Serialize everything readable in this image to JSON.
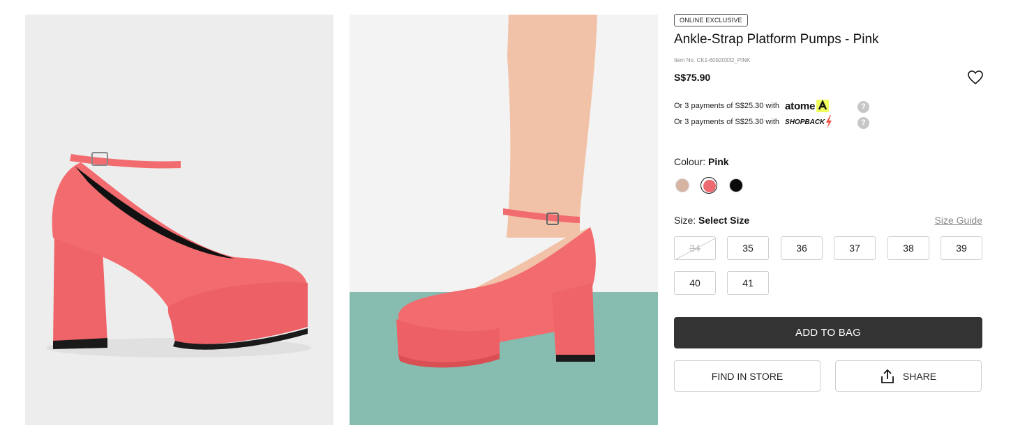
{
  "product": {
    "badge": "ONLINE EXCLUSIVE",
    "title": "Ankle-Strap Platform Pumps - Pink",
    "item_no": "Item No. CK1-60920332_PINK",
    "price": "S$75.90"
  },
  "payments": [
    {
      "text": "Or 3 payments of S$25.30 with",
      "provider": "atome"
    },
    {
      "text": "Or 3 payments of S$25.30 with",
      "provider": "SHOPBACK"
    }
  ],
  "help_icon_glyph": "?",
  "colour": {
    "label": "Colour:",
    "selected": "Pink",
    "swatches": [
      {
        "name": "nude",
        "hex": "#d7b3a3"
      },
      {
        "name": "pink",
        "hex": "#ec6a70"
      },
      {
        "name": "black",
        "hex": "#0a0a0a"
      }
    ]
  },
  "size": {
    "label": "Size:",
    "selected": "Select Size",
    "guide": "Size Guide",
    "options": [
      "34",
      "35",
      "36",
      "37",
      "38",
      "39",
      "40",
      "41"
    ],
    "unavailable": [
      "34"
    ]
  },
  "buttons": {
    "add_to_bag": "ADD TO BAG",
    "find_in_store": "FIND IN STORE",
    "share": "SHARE"
  },
  "colors": {
    "shoe_pink": "#f26b6f",
    "button_dark": "#333333",
    "atome_yellow": "#f0ff5f",
    "shopback_red": "#f04e3e"
  },
  "icons": {
    "wishlist": "heart-outline-icon",
    "share": "upload-share-icon",
    "help": "question-circle-icon"
  }
}
